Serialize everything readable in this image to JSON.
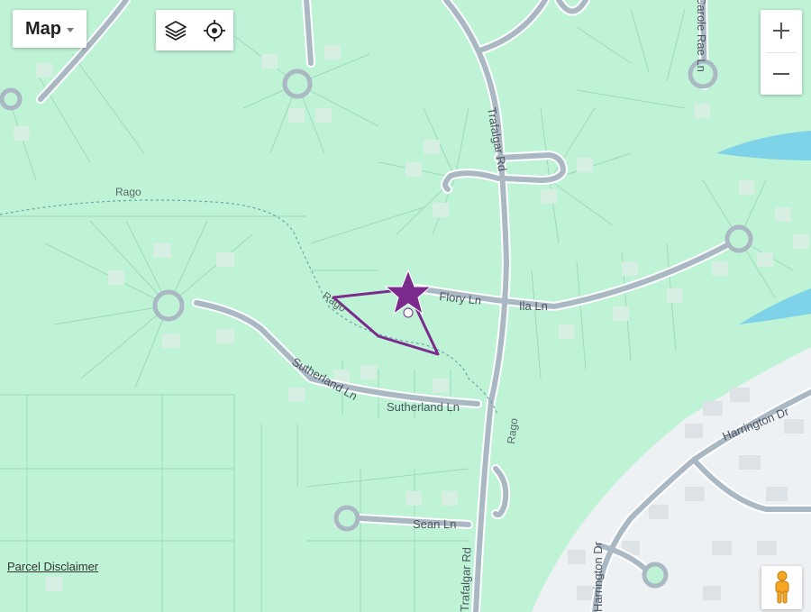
{
  "map": {
    "map_type_label": "Map",
    "road_labels": {
      "trafalgar_upper": "Trafalgar Rd",
      "trafalgar_lower": "Trafalgar Rd",
      "flory": "Flory Ln",
      "ila": "Ila Ln",
      "sutherland_left": "Sutherland Ln",
      "sutherland_right": "Sutherland Ln",
      "sean": "Sean Ln",
      "harrington_dr": "Harrington Dr",
      "harrington_lower": "Harrington Dr",
      "carole_rae": "Carole Rae Ln"
    },
    "trail_labels": {
      "rago_top": "Rago",
      "rago_mid": "Rago",
      "rago_right": "Rago"
    },
    "parcel_disclaimer": "Parcel Disclaimer",
    "colors": {
      "land": "#bff3d6",
      "parcel_line": "#9ed9bb",
      "road": "#aab8c4",
      "road_casing": "#ffffff",
      "water": "#7fd3e8",
      "urban": "#eef1f3",
      "marker": "#7b2a8e",
      "polygon": "#7b2a8e"
    },
    "icons": {
      "layers": "layers-icon",
      "locate": "locate-icon",
      "zoom_in": "plus-icon",
      "zoom_out": "minus-icon",
      "marker": "star-marker-icon",
      "street_view": "pegman-icon"
    }
  }
}
